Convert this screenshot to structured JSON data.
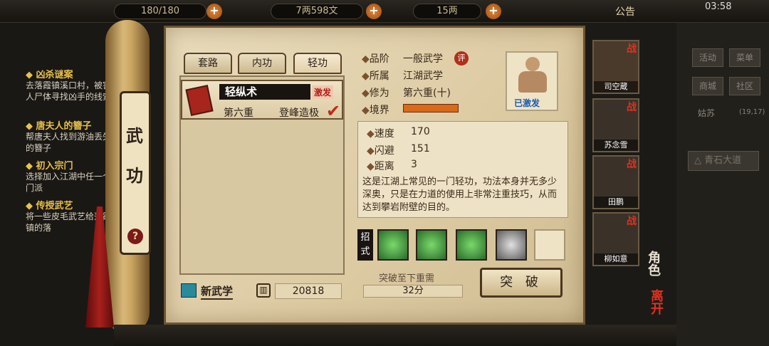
{
  "topbar": {
    "stamina": "180/180",
    "money": "7两598文",
    "gold": "15两",
    "notice": "公告",
    "time": "03:58"
  },
  "quests": [
    {
      "title": "凶杀谜案",
      "desc": "去落霞镇溪口村，被害人尸体寻找凶手的线索"
    },
    {
      "title": "唐夫人的簪子",
      "desc": "帮唐夫人找到游油丢失的簪子"
    },
    {
      "title": "初入宗门",
      "desc": "选择加入江湖中任一个门派"
    },
    {
      "title": "传授武艺",
      "desc": "将一些皮毛武艺给落霞镇的落"
    }
  ],
  "right": {
    "btns": [
      "活动",
      "菜单",
      "商城",
      "社区"
    ],
    "location": "姑苏",
    "coords": "(19,17)",
    "road": "青石大道",
    "role_label": "角色",
    "leave_label": "离开"
  },
  "scroll": {
    "title": "武\n\n功",
    "help": "?"
  },
  "tabs": [
    "套路",
    "内功",
    "轻功"
  ],
  "skill": {
    "name": "轻纵术",
    "badge": "激发",
    "level": "第六重",
    "status": "登峰造极"
  },
  "info": {
    "grade_label": "品阶",
    "grade": "一般武学",
    "grade_badge": "评",
    "belong_label": "所属",
    "belong": "江湖武学",
    "practice_label": "修为",
    "practice": "第六重(十)",
    "realm_label": "境界",
    "activated": "已激发"
  },
  "stats": [
    {
      "label": "速度",
      "value": "170"
    },
    {
      "label": "闪避",
      "value": "151"
    },
    {
      "label": "距离",
      "value": "3"
    }
  ],
  "description": "这是江湖上常见的一门轻功，功法本身并无多少深奥，只是在力道的使用上非常注重技巧，从而达到攀岩附壁的目的。",
  "moves_label": "招式",
  "breakthrough": {
    "need_label": "突破至下重需",
    "need_value": "32分",
    "button": "突 破"
  },
  "footer": {
    "new_label": "新武学",
    "points": "20818"
  },
  "team": [
    {
      "name": "司空蔵",
      "tag": "战"
    },
    {
      "name": "苏念雪",
      "tag": "战"
    },
    {
      "name": "田鹏",
      "tag": "战"
    },
    {
      "name": "柳如意",
      "tag": "战"
    }
  ],
  "colors": {
    "accent": "#c23a1a",
    "paper": "#e2d3b0",
    "gold": "#e8c14a"
  }
}
